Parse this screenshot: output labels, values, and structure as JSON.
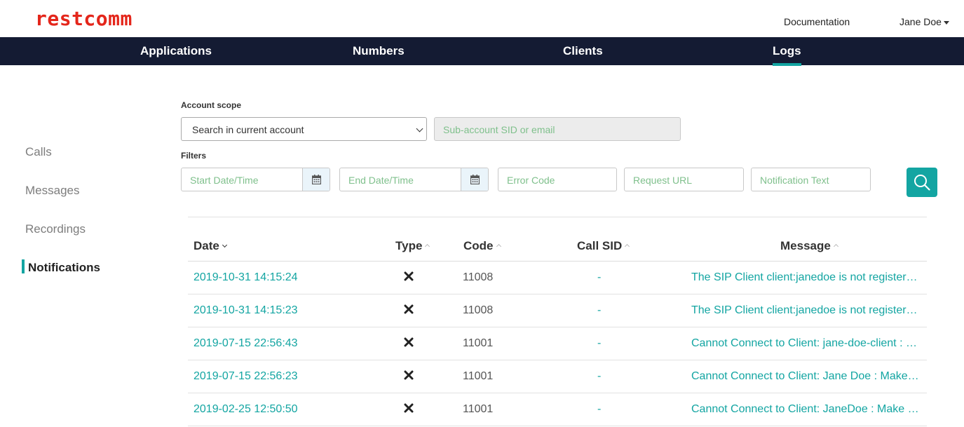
{
  "app": {
    "logo_text": "restcomm"
  },
  "header": {
    "documentation_label": "Documentation",
    "user_name": "Jane Doe"
  },
  "nav": {
    "applications": "Applications",
    "numbers": "Numbers",
    "clients": "Clients",
    "logs": "Logs",
    "active": "Logs"
  },
  "sidebar": {
    "calls": "Calls",
    "messages": "Messages",
    "recordings": "Recordings",
    "notifications": "Notifications",
    "active": "Notifications"
  },
  "form": {
    "account_scope_label": "Account scope",
    "scope_select_value": "Search in current account",
    "subaccount_placeholder": "Sub-account SID or email",
    "filters_label": "Filters",
    "start_date_placeholder": "Start Date/Time",
    "end_date_placeholder": "End Date/Time",
    "error_code_placeholder": "Error Code",
    "request_url_placeholder": "Request URL",
    "notification_text_placeholder": "Notification Text",
    "search_icon": "search-icon",
    "calendar_icon": "calendar-icon"
  },
  "table": {
    "columns": {
      "date": "Date",
      "type": "Type",
      "code": "Code",
      "call_sid": "Call SID",
      "message": "Message"
    },
    "rows": [
      {
        "date": "2019-10-31 14:15:24",
        "type_icon": "error-x-icon",
        "code": "11008",
        "call_sid": "-",
        "message": "The SIP Client client:janedoe is not registered or does not exist"
      },
      {
        "date": "2019-10-31 14:15:23",
        "type_icon": "error-x-icon",
        "code": "11008",
        "call_sid": "-",
        "message": "The SIP Client client:janedoe is not registered or does not exist"
      },
      {
        "date": "2019-07-15 22:56:43",
        "type_icon": "error-x-icon",
        "code": "11001",
        "call_sid": "-",
        "message": "Cannot Connect to Client: jane-doe-client : Make sure the client is online"
      },
      {
        "date": "2019-07-15 22:56:23",
        "type_icon": "error-x-icon",
        "code": "11001",
        "call_sid": "-",
        "message": "Cannot Connect to Client: Jane Doe : Make sure the client is online"
      },
      {
        "date": "2019-02-25 12:50:50",
        "type_icon": "error-x-icon",
        "code": "11001",
        "call_sid": "-",
        "message": "Cannot Connect to Client: JaneDoe : Make sure the client is online"
      }
    ]
  },
  "colors": {
    "brand": "#e4261b",
    "accent": "#13a5a2",
    "navbar": "#141b33"
  }
}
